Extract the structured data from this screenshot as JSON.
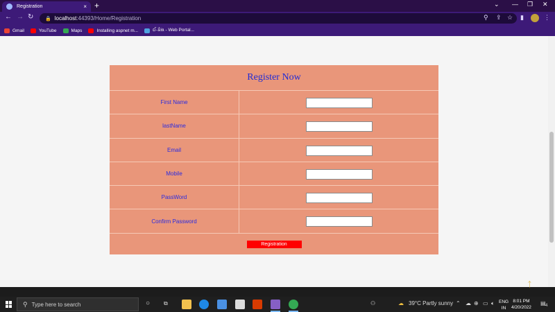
{
  "browser": {
    "tab_title": "Registration",
    "tab_close": "×",
    "new_tab": "+",
    "window_controls": [
      "⌄",
      "—",
      "❐",
      "✕"
    ],
    "url_host": "localhost",
    "url_path": ":44393/Home/Registration",
    "bookmarks": [
      {
        "label": "Gmail",
        "color": "#ea4335"
      },
      {
        "label": "YouTube",
        "color": "#ff0000"
      },
      {
        "label": "Maps",
        "color": "#34a853"
      },
      {
        "label": "Installing aspnet m...",
        "color": "#ff0000"
      },
      {
        "label": "ઈ-પ્રેસ - Web Portal...",
        "color": "#4fa3e0"
      }
    ]
  },
  "form": {
    "title": "Register Now",
    "fields": [
      {
        "label": "First Name",
        "value": ""
      },
      {
        "label": "lastName",
        "value": ""
      },
      {
        "label": "Email",
        "value": ""
      },
      {
        "label": "Mobile",
        "value": ""
      },
      {
        "label": "PassWord",
        "value": ""
      },
      {
        "label": "Confirm Password",
        "value": ""
      }
    ],
    "submit_label": "Registration",
    "background_color": "#e9967a",
    "label_color": "#2a2be0",
    "submit_color": "#ff0000"
  },
  "taskbar": {
    "search_placeholder": "Type here to search",
    "weather": "39°C  Partly sunny",
    "language_line1": "ENG",
    "language_line2": "IN",
    "time": "8:01 PM",
    "date": "4/20/2022",
    "notification_count": "4"
  }
}
